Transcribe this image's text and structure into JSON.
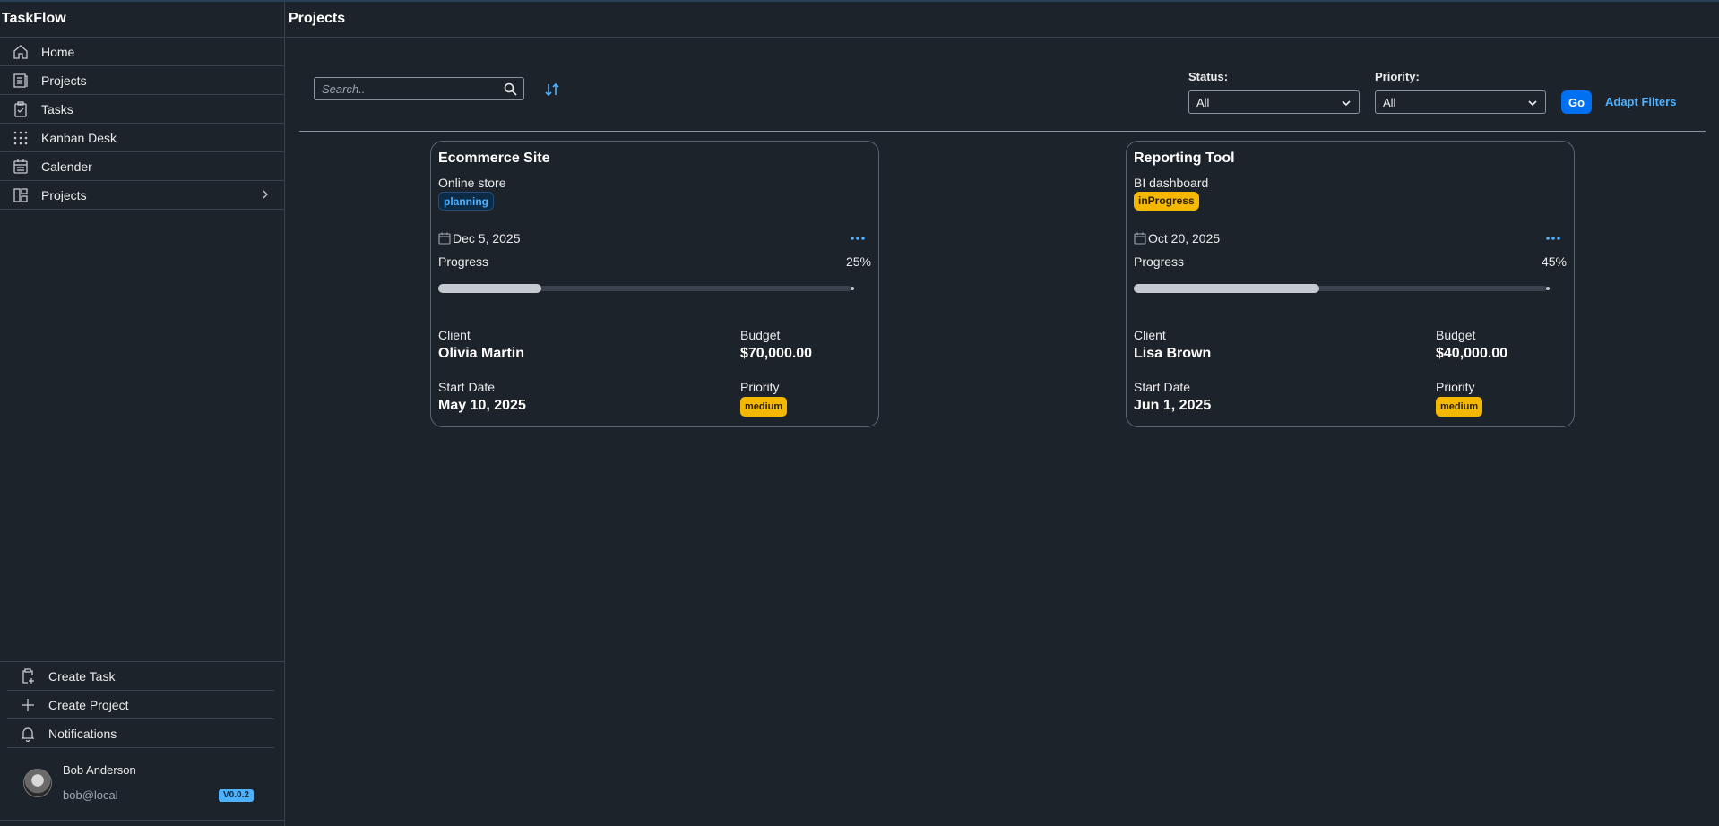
{
  "app": {
    "name": "TaskFlow"
  },
  "sidebar": {
    "items": [
      {
        "label": "Home",
        "icon": "home-icon"
      },
      {
        "label": "Projects",
        "icon": "projects-list-icon"
      },
      {
        "label": "Tasks",
        "icon": "clipboard-check-icon"
      },
      {
        "label": "Kanban Desk",
        "icon": "grid-dots-icon"
      },
      {
        "label": "Calender",
        "icon": "calendar-icon"
      },
      {
        "label": "Projects",
        "icon": "dashboard-layout-icon",
        "expandable": true
      }
    ],
    "bottom_items": [
      {
        "label": "Create Task",
        "icon": "clipboard-add-icon"
      },
      {
        "label": "Create Project",
        "icon": "plus-icon"
      },
      {
        "label": "Notifications",
        "icon": "bell-icon"
      }
    ],
    "user": {
      "name": "Bob Anderson",
      "email": "bob@local",
      "version": "V0.0.2"
    }
  },
  "page": {
    "title": "Projects"
  },
  "toolbar": {
    "search_placeholder": "Search..",
    "status_label": "Status:",
    "status_value": "All",
    "priority_label": "Priority:",
    "priority_value": "All",
    "go_label": "Go",
    "adapt_filters_label": "Adapt Filters"
  },
  "colors": {
    "background": "#1d232a",
    "accent": "#0070f2",
    "link": "#4db1ff",
    "warning_tag": "#f5b800",
    "border": "#39424d"
  },
  "projects": [
    {
      "title": "Ecommerce Site",
      "description": "Online store",
      "status": "planning",
      "due_date": "Dec 5, 2025",
      "progress_label": "Progress",
      "progress": 25,
      "progress_text": "25%",
      "client_label": "Client",
      "client": "Olivia Martin",
      "budget_label": "Budget",
      "budget": "$70,000.00",
      "start_label": "Start Date",
      "start_date": "May 10, 2025",
      "priority_label": "Priority",
      "priority": "medium"
    },
    {
      "title": "Reporting Tool",
      "description": "BI dashboard",
      "status": "inProgress",
      "due_date": "Oct 20, 2025",
      "progress_label": "Progress",
      "progress": 45,
      "progress_text": "45%",
      "client_label": "Client",
      "client": "Lisa Brown",
      "budget_label": "Budget",
      "budget": "$40,000.00",
      "start_label": "Start Date",
      "start_date": "Jun 1, 2025",
      "priority_label": "Priority",
      "priority": "medium"
    }
  ]
}
